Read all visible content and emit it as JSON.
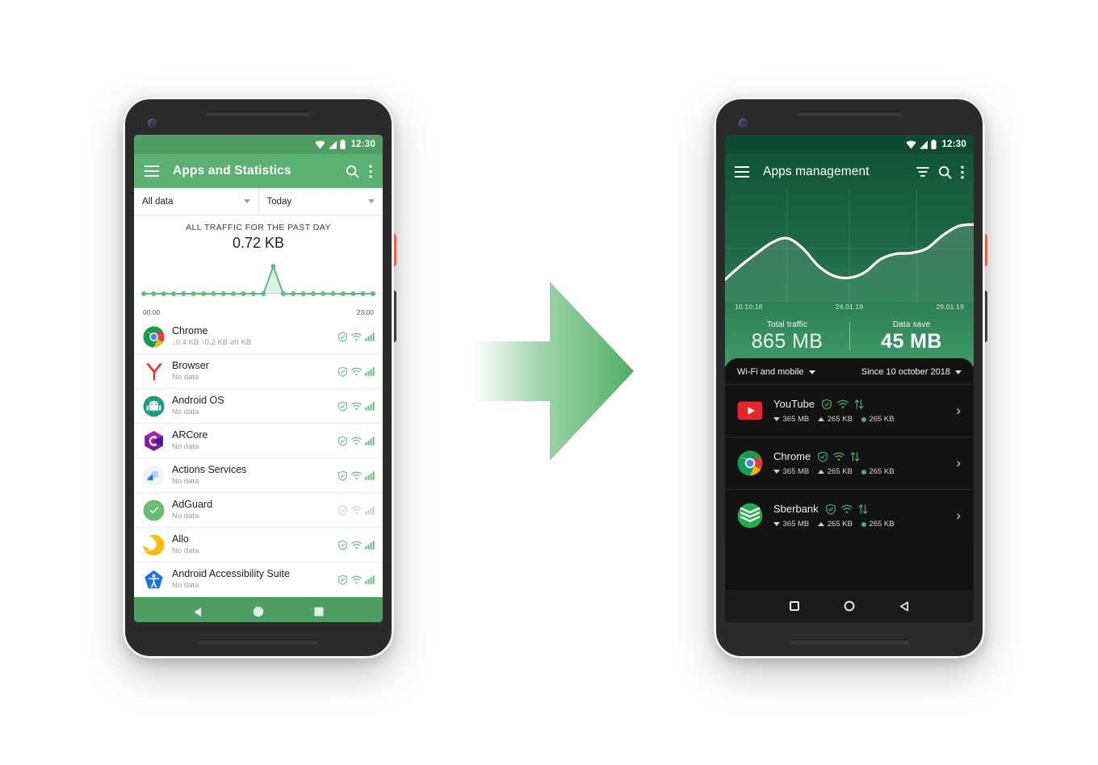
{
  "scene": {
    "arrow_color": "#5FB870",
    "background": "#FFFFFF"
  },
  "left_phone": {
    "status_bar": {
      "time": "12:30",
      "icons": [
        "wifi-icon",
        "signal-icon",
        "battery-icon"
      ]
    },
    "toolbar": {
      "menu_icon": "hamburger-icon",
      "title": "Apps and Statistics",
      "search_icon": "search-icon",
      "overflow_icon": "more-vert-icon",
      "color": "#5BB172"
    },
    "filters": [
      {
        "label": "All data",
        "caret": "chevron-down-icon"
      },
      {
        "label": "Today",
        "caret": "chevron-down-icon"
      }
    ],
    "chart_card": {
      "caption": "ALL TRAFFIC FOR THE PAST DAY",
      "value": "0.72 KB",
      "axis_start": "00:00",
      "axis_end": "23:00"
    },
    "apps": [
      {
        "name": "Chrome",
        "sub": "↓0.4 KB ↑0.2 KB ⌀0 KB",
        "icon": "chrome-icon",
        "enabled": true
      },
      {
        "name": "Browser",
        "sub": "No data",
        "icon": "yandex-browser-icon",
        "enabled": true
      },
      {
        "name": "Android OS",
        "sub": "No data",
        "icon": "android-os-icon",
        "enabled": true
      },
      {
        "name": "ARCore",
        "sub": "No data",
        "icon": "arcore-icon",
        "enabled": true
      },
      {
        "name": "Actions Services",
        "sub": "No data",
        "icon": "actions-services-icon",
        "enabled": true
      },
      {
        "name": "AdGuard",
        "sub": "No data",
        "icon": "adguard-icon",
        "enabled": false
      },
      {
        "name": "Allo",
        "sub": "No data",
        "icon": "allo-icon",
        "enabled": true
      },
      {
        "name": "Android Accessibility Suite",
        "sub": "No data",
        "icon": "accessibility-suite-icon",
        "enabled": true
      }
    ],
    "row_status_icons": [
      "shield-icon",
      "wifi-icon",
      "signal-bars-icon"
    ],
    "nav_bar": {
      "color": "#4E9E64",
      "buttons": [
        "back-triangle-icon",
        "home-circle-icon",
        "recents-square-icon"
      ]
    }
  },
  "right_phone": {
    "status_bar": {
      "time": "12:30",
      "icons": [
        "wifi-icon",
        "signal-icon",
        "battery-icon"
      ]
    },
    "toolbar": {
      "menu_icon": "hamburger-icon",
      "title": "Apps management",
      "filter_icon": "filter-sort-icon",
      "search_icon": "search-icon",
      "overflow_icon": "more-vert-icon"
    },
    "hero_dates": [
      "10.10.18",
      "24.01.18",
      "29.01.19"
    ],
    "stats": [
      {
        "label": "Total traffic",
        "value": "865 MB",
        "emphasis": "light"
      },
      {
        "label": "Data save",
        "value": "45 MB",
        "emphasis": "bold"
      }
    ],
    "sheet_filters": [
      {
        "label": "Wi-Fi and mobile",
        "caret": "chevron-down-icon"
      },
      {
        "label": "Since 10 october 2018",
        "caret": "chevron-down-icon"
      }
    ],
    "apps": [
      {
        "name": "YouTube",
        "icon": "youtube-icon",
        "status_icons": [
          "shield-icon",
          "wifi-icon",
          "transfer-arrows-icon"
        ],
        "download": "365 MB",
        "upload": "265 KB",
        "saved": "265 KB",
        "chevron": "chevron-right-icon"
      },
      {
        "name": "Chrome",
        "icon": "chrome-icon",
        "status_icons": [
          "shield-icon",
          "wifi-icon",
          "transfer-arrows-icon"
        ],
        "download": "365 MB",
        "upload": "265 KB",
        "saved": "265 KB",
        "chevron": "chevron-right-icon"
      },
      {
        "name": "Sberbank",
        "icon": "sberbank-icon",
        "status_icons": [
          "shield-icon",
          "wifi-icon",
          "transfer-arrows-icon"
        ],
        "download": "365 MB",
        "upload": "265 KB",
        "saved": "265 KB",
        "chevron": "chevron-right-icon"
      }
    ],
    "nav_bar": {
      "color": "#1B1B1B",
      "buttons": [
        "recents-square-icon",
        "home-circle-icon",
        "back-triangle-icon"
      ]
    }
  },
  "chart_data": [
    {
      "type": "line",
      "title": "ALL TRAFFIC FOR THE PAST DAY",
      "subtitle": "0.72 KB",
      "xlabel": "",
      "ylabel": "",
      "x": [
        "00:00",
        "01:00",
        "02:00",
        "03:00",
        "04:00",
        "05:00",
        "06:00",
        "07:00",
        "08:00",
        "09:00",
        "10:00",
        "11:00",
        "12:00",
        "13:00",
        "14:00",
        "15:00",
        "16:00",
        "17:00",
        "18:00",
        "19:00",
        "20:00",
        "21:00",
        "22:00",
        "23:00"
      ],
      "values": [
        0,
        0,
        0,
        0,
        0,
        0,
        0,
        0,
        0,
        0,
        0,
        0,
        0,
        0.72,
        0,
        0,
        0,
        0,
        0,
        0,
        0,
        0,
        0,
        0
      ],
      "tick_labels": [
        "00:00",
        "23:00"
      ],
      "ylim": [
        0,
        0.8
      ],
      "grid": false,
      "legend": "none",
      "markers": true,
      "color": "#5EBE79"
    },
    {
      "type": "area",
      "title": "",
      "xlabel": "",
      "ylabel": "",
      "x": [
        "10.10.18",
        "24.01.18",
        "29.01.19"
      ],
      "tick_labels": [
        "10.10.18",
        "24.01.18",
        "29.01.19"
      ],
      "values": [
        18,
        33,
        46,
        58,
        63,
        52,
        33,
        22,
        20,
        26,
        40,
        46,
        47,
        52,
        66,
        76,
        78
      ],
      "ylim": [
        0,
        100
      ],
      "grid": true,
      "legend": "none",
      "color": "#FFFFFF"
    }
  ]
}
